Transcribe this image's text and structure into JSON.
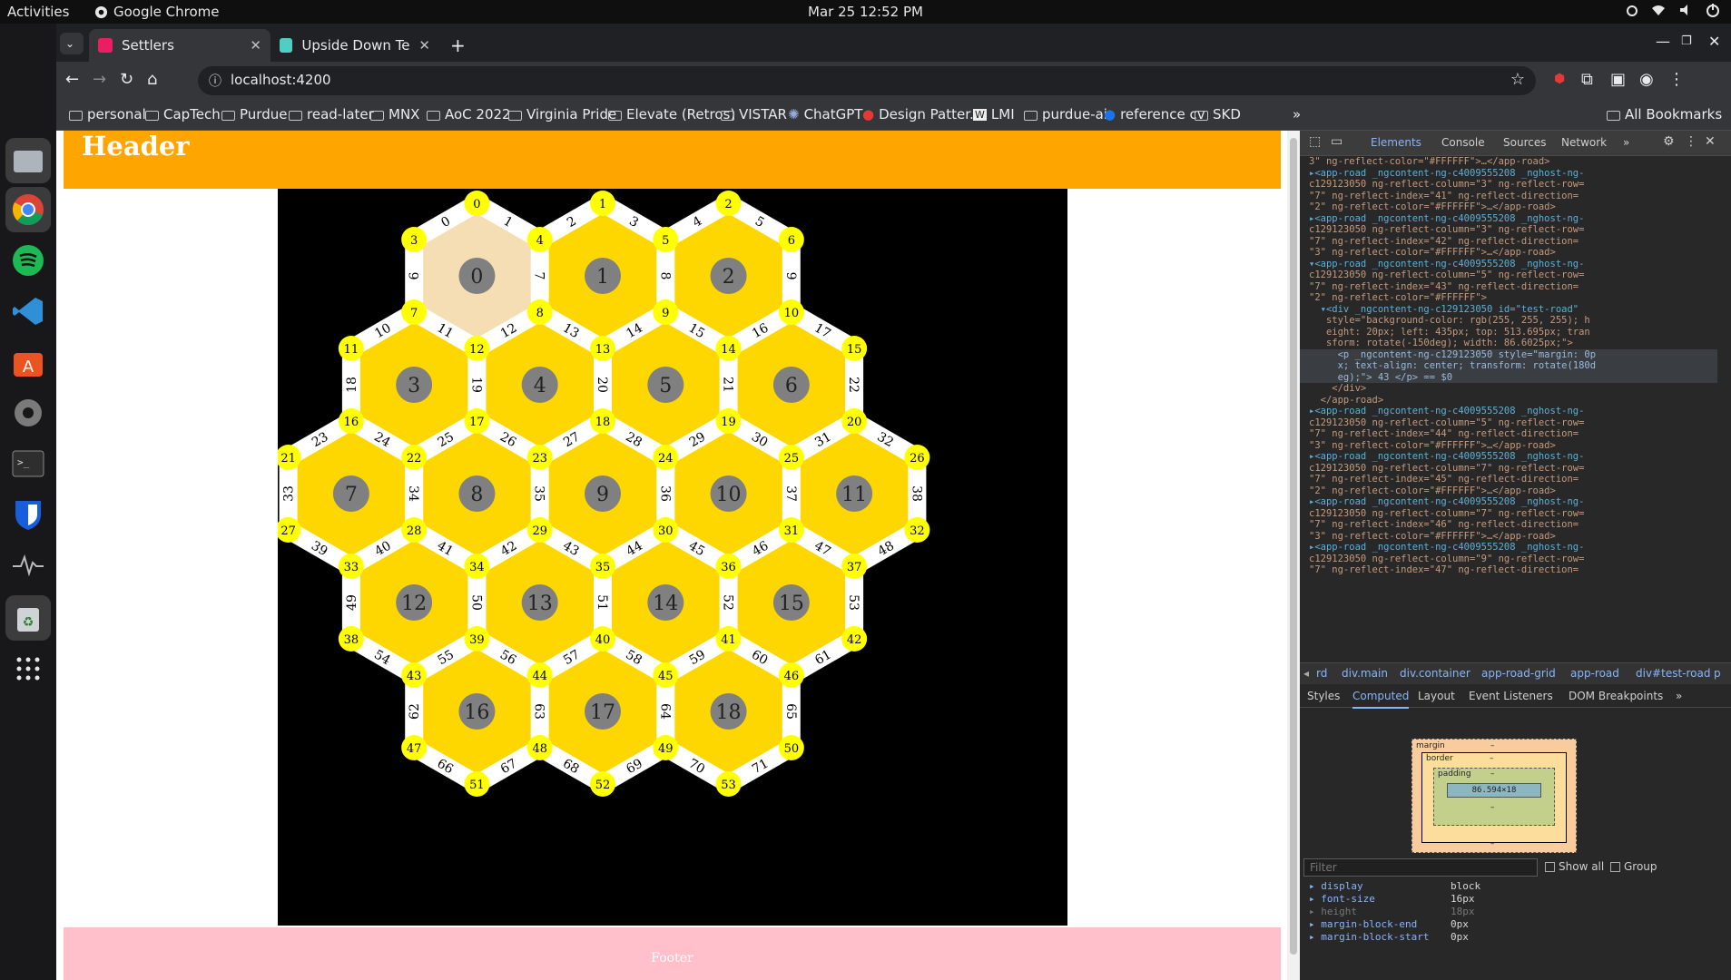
{
  "os": {
    "activities": "Activities",
    "app_name": "Google Chrome",
    "clock": "Mar 25  12:52 PM"
  },
  "browser": {
    "tabs": [
      {
        "title": "Settlers",
        "active": true,
        "favicon_color": "#e91e63"
      },
      {
        "title": "Upside Down Text | Emw",
        "active": false,
        "favicon_color": "#4dd0c4"
      }
    ],
    "url": "localhost:4200",
    "bookmarks": [
      "personal",
      "CapTech",
      "Purdue",
      "read-later",
      "MNX",
      "AoC 2022",
      "Virginia Pride",
      "Elevate (Retros)",
      "VISTAR",
      "ChatGPT",
      "Design Patter...",
      "LMI",
      "purdue-ai",
      "reference cv",
      "SKD"
    ],
    "all_bookmarks": "All Bookmarks",
    "overflow": "»"
  },
  "page": {
    "header": "Header",
    "footer": "Footer",
    "colors": {
      "header": "#ffa500",
      "footer": "#ffc0cb",
      "tile": "#ffd700",
      "tile_selected": "#f5deb3",
      "node": "#ffff00",
      "board": "#000000",
      "token": "#808080"
    },
    "rows": [
      3,
      4,
      5,
      4,
      3
    ],
    "tiles": [
      "0",
      "1",
      "2",
      "3",
      "4",
      "5",
      "6",
      "7",
      "8",
      "9",
      "10",
      "11",
      "12",
      "13",
      "14",
      "15",
      "16",
      "17",
      "18"
    ],
    "selected_tile": 0,
    "nodes": [
      "0",
      "1",
      "2",
      "3",
      "4",
      "5",
      "6",
      "7",
      "8",
      "9",
      "10",
      "11",
      "12",
      "13",
      "14",
      "15",
      "16",
      "17",
      "18",
      "19",
      "20",
      "21",
      "22",
      "23",
      "24",
      "25",
      "26",
      "27",
      "28",
      "29",
      "30",
      "31",
      "32",
      "33",
      "34",
      "35",
      "36",
      "37",
      "38",
      "39",
      "40",
      "41",
      "42",
      "43",
      "44",
      "45",
      "46",
      "47",
      "48",
      "49",
      "50",
      "51",
      "52",
      "53"
    ],
    "roads": [
      "0",
      "1",
      "2",
      "3",
      "4",
      "5",
      "6",
      "7",
      "8",
      "9",
      "10",
      "11",
      "12",
      "13",
      "14",
      "15",
      "16",
      "17",
      "18",
      "19",
      "20",
      "21",
      "22",
      "23",
      "24",
      "25",
      "26",
      "27",
      "28",
      "29",
      "30",
      "31",
      "32",
      "33",
      "34",
      "35",
      "36",
      "37",
      "38",
      "39",
      "40",
      "41",
      "42",
      "43",
      "44",
      "45",
      "46",
      "47",
      "48",
      "49",
      "50",
      "51",
      "52",
      "53",
      "54",
      "55",
      "56",
      "57",
      "58",
      "59",
      "60",
      "61",
      "62",
      "63",
      "64",
      "65",
      "66",
      "67",
      "68",
      "69",
      "70",
      "71"
    ]
  },
  "devtools": {
    "tabs": [
      "Elements",
      "Console",
      "Sources",
      "Network",
      "»"
    ],
    "dom_lines": [
      {
        "type": "x",
        "text": "3\" ng-reflect-color=\"#FFFFFF\">…</app-road>"
      },
      {
        "type": "t",
        "text": "▸<app-road _ngcontent-ng-c4009555208 _nghost-ng-"
      },
      {
        "type": "x",
        "text": "c129123050 ng-reflect-column=\"3\" ng-reflect-row="
      },
      {
        "type": "x",
        "text": "\"7\" ng-reflect-index=\"41\" ng-reflect-direction="
      },
      {
        "type": "x",
        "text": "\"2\" ng-reflect-color=\"#FFFFFF\">…</app-road>"
      },
      {
        "type": "t",
        "text": "▸<app-road _ngcontent-ng-c4009555208 _nghost-ng-"
      },
      {
        "type": "x",
        "text": "c129123050 ng-reflect-column=\"3\" ng-reflect-row="
      },
      {
        "type": "x",
        "text": "\"7\" ng-reflect-index=\"42\" ng-reflect-direction="
      },
      {
        "type": "x",
        "text": "\"3\" ng-reflect-color=\"#FFFFFF\">…</app-road>"
      },
      {
        "type": "t",
        "text": "▾<app-road _ngcontent-ng-c4009555208 _nghost-ng-"
      },
      {
        "type": "x",
        "text": "c129123050 ng-reflect-column=\"5\" ng-reflect-row="
      },
      {
        "type": "x",
        "text": "\"7\" ng-reflect-index=\"43\" ng-reflect-direction="
      },
      {
        "type": "x",
        "text": "\"2\" ng-reflect-color=\"#FFFFFF\">"
      },
      {
        "type": "t",
        "text": "  ▾<div _ngcontent-ng-c129123050 id=\"test-road\""
      },
      {
        "type": "x",
        "text": "   style=\"background-color: rgb(255, 255, 255); h"
      },
      {
        "type": "x",
        "text": "   eight: 20px; left: 435px; top: 513.695px; tran"
      },
      {
        "type": "x",
        "text": "   sform: rotate(-150deg); width: 86.6025px;\">"
      },
      {
        "type": "s",
        "text": "     <p _ngcontent-ng-c129123050 style=\"margin: 0p"
      },
      {
        "type": "s",
        "text": "     x; text-align: center; transform: rotate(180d"
      },
      {
        "type": "s",
        "text": "     eg);\"> 43 </p> == $0"
      },
      {
        "type": "x",
        "text": "    </div>"
      },
      {
        "type": "x",
        "text": "  </app-road>"
      },
      {
        "type": "t",
        "text": "▸<app-road _ngcontent-ng-c4009555208 _nghost-ng-"
      },
      {
        "type": "x",
        "text": "c129123050 ng-reflect-column=\"5\" ng-reflect-row="
      },
      {
        "type": "x",
        "text": "\"7\" ng-reflect-index=\"44\" ng-reflect-direction="
      },
      {
        "type": "x",
        "text": "\"3\" ng-reflect-color=\"#FFFFFF\">…</app-road>"
      },
      {
        "type": "t",
        "text": "▸<app-road _ngcontent-ng-c4009555208 _nghost-ng-"
      },
      {
        "type": "x",
        "text": "c129123050 ng-reflect-column=\"7\" ng-reflect-row="
      },
      {
        "type": "x",
        "text": "\"7\" ng-reflect-index=\"45\" ng-reflect-direction="
      },
      {
        "type": "x",
        "text": "\"2\" ng-reflect-color=\"#FFFFFF\">…</app-road>"
      },
      {
        "type": "t",
        "text": "▸<app-road _ngcontent-ng-c4009555208 _nghost-ng-"
      },
      {
        "type": "x",
        "text": "c129123050 ng-reflect-column=\"7\" ng-reflect-row="
      },
      {
        "type": "x",
        "text": "\"7\" ng-reflect-index=\"46\" ng-reflect-direction="
      },
      {
        "type": "x",
        "text": "\"3\" ng-reflect-color=\"#FFFFFF\">…</app-road>"
      },
      {
        "type": "t",
        "text": "▸<app-road _ngcontent-ng-c4009555208 _nghost-ng-"
      },
      {
        "type": "x",
        "text": "c129123050 ng-reflect-column=\"9\" ng-reflect-row="
      },
      {
        "type": "x",
        "text": "\"7\" ng-reflect-index=\"47\" ng-reflect-direction="
      }
    ],
    "breadcrumbs": [
      "rd",
      "div.main",
      "div.container",
      "app-road-grid",
      "app-road",
      "div#test-road",
      "p"
    ],
    "subtabs": [
      "Styles",
      "Computed",
      "Layout",
      "Event Listeners",
      "DOM Breakpoints",
      "»"
    ],
    "boxmodel": {
      "margin": "margin",
      "border": "border",
      "padding": "padding",
      "content": "86.594×18",
      "dash": "–"
    },
    "filter_placeholder": "Filter",
    "show_all": "Show all",
    "group": "Group",
    "computed": [
      {
        "name": "display",
        "value": "block",
        "dim": false
      },
      {
        "name": "font-size",
        "value": "16px",
        "dim": false
      },
      {
        "name": "height",
        "value": "18px",
        "dim": true
      },
      {
        "name": "margin-block-end",
        "value": "0px",
        "dim": false
      },
      {
        "name": "margin-block-start",
        "value": "0px",
        "dim": false
      }
    ]
  }
}
